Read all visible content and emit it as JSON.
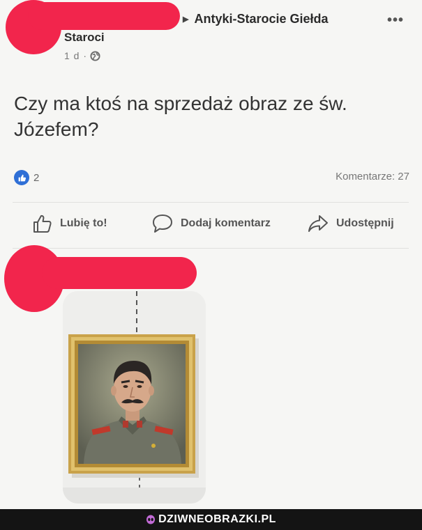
{
  "header": {
    "group_name_line1": "Antyki-Starocie Giełda",
    "group_name_line2": "Staroci",
    "timestamp": "1 d ·",
    "more_icon": "more-dots-icon",
    "privacy_icon": "globe-icon"
  },
  "post": {
    "text": "Czy ma ktoś na sprzedaż obraz ze św. Józefem?"
  },
  "reactions": {
    "count": "2",
    "icon": "like-reaction-icon",
    "comments_label": "Komentarze: 27"
  },
  "actions": {
    "like_label": "Lubię to!",
    "comment_label": "Dodaj komentarz",
    "share_label": "Udostępnij"
  },
  "comment": {
    "photo_alt": "portrait-painting-in-gold-frame"
  },
  "footer": {
    "brand": "DZIWNEOBRAZKI.PL"
  },
  "colors": {
    "redaction": "#f2254c",
    "like_blue": "#2f6fd6",
    "footer_bg": "#141414",
    "frame_gold": "#c9a24a"
  }
}
